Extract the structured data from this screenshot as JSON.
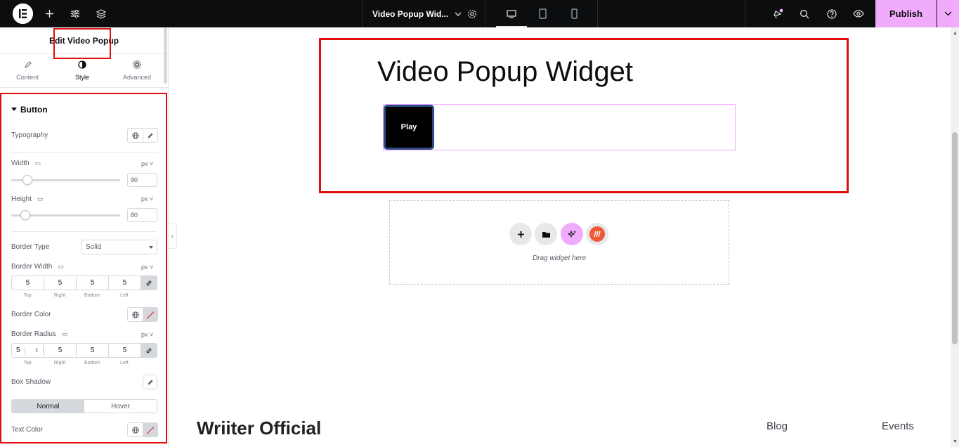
{
  "topbar": {
    "document_title": "Video Popup Wid...",
    "publish_label": "Publish"
  },
  "panel": {
    "header": "Edit Video Popup",
    "tabs": [
      {
        "label": "Content",
        "icon": "pencil-icon"
      },
      {
        "label": "Style",
        "icon": "half-circle-icon",
        "active": true
      },
      {
        "label": "Advanced",
        "icon": "gear-icon"
      }
    ],
    "section": "Button",
    "typography_label": "Typography",
    "width": {
      "label": "Width",
      "unit": "px",
      "value": "90",
      "slider_fraction": 0.15
    },
    "height": {
      "label": "Height",
      "unit": "px",
      "value": "80",
      "slider_fraction": 0.13
    },
    "border_type": {
      "label": "Border Type",
      "value": "Solid"
    },
    "border_width": {
      "label": "Border Width",
      "unit": "px",
      "values": [
        "5",
        "5",
        "5",
        "5"
      ]
    },
    "dimension_labels": [
      "Top",
      "Right",
      "Bottom",
      "Left"
    ],
    "border_color_label": "Border Color",
    "border_radius": {
      "label": "Border Radius",
      "unit": "px",
      "values": [
        "5",
        "5",
        "5",
        "5"
      ]
    },
    "box_shadow_label": "Box Shadow",
    "state_toggle": {
      "normal": "Normal",
      "hover": "Hover",
      "active": "Normal"
    },
    "text_color_label": "Text Color"
  },
  "canvas": {
    "widget_title": "Video Popup Widget",
    "play_label": "Play",
    "drop_text": "Drag widget here",
    "footer_brand": "Wriiter Official",
    "footer_links": [
      "Blog",
      "Events"
    ]
  },
  "colors": {
    "accent": "#f0abfc",
    "highlight": "#e10d0d",
    "topbar": "#0c0d0e"
  }
}
